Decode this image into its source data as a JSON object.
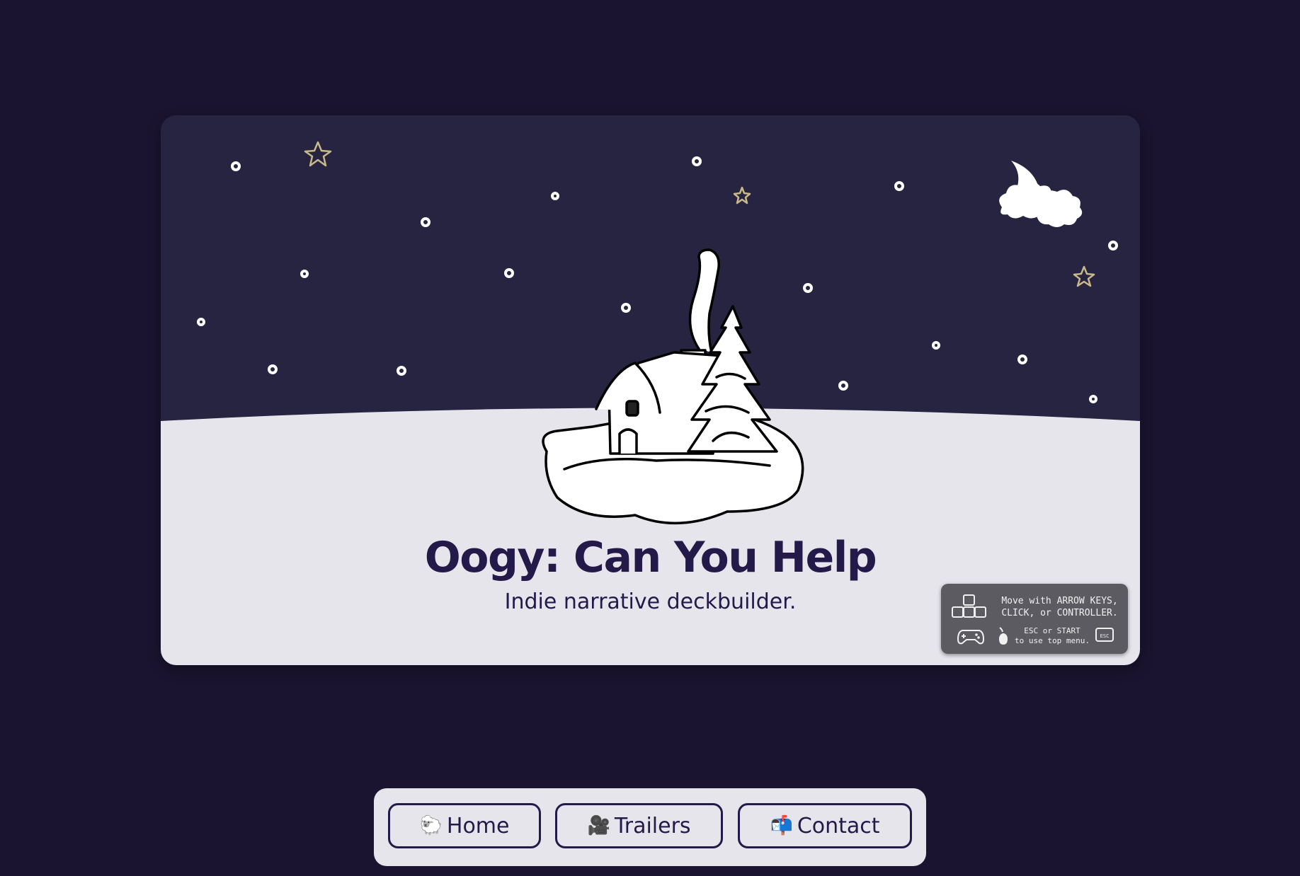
{
  "hero": {
    "title": "Oogy: Can You Help",
    "subtitle": "Indie narrative deckbuilder."
  },
  "controls_hint": {
    "line1": "Move with ARROW KEYS,",
    "line2": "CLICK, or CONTROLLER.",
    "line3": "ESC or START",
    "line4": "to use top menu.",
    "key_label": "ESC"
  },
  "nav": {
    "items": [
      {
        "emoji": "🐑",
        "label": "Home"
      },
      {
        "emoji": "🎥",
        "label": "Trailers"
      },
      {
        "emoji": "📬",
        "label": "Contact"
      }
    ]
  },
  "colors": {
    "page_bg": "#1a1430",
    "sky": "#262441",
    "snow": "#e6e5ec",
    "accent_text": "#241a4a",
    "star_gold": "#c9b98a"
  }
}
